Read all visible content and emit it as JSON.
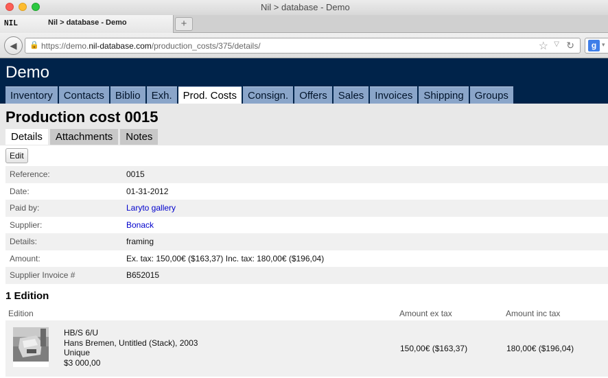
{
  "window": {
    "title": "Nil > database - Demo"
  },
  "browser": {
    "tab_logo": "NIL",
    "tab_title": "Nil > database - Demo",
    "new_tab": "+",
    "url_prefix": "https://demo.",
    "url_domain": "nil-database.com",
    "url_path": "/production_costs/375/details/",
    "search_engine_icon": "g"
  },
  "site": {
    "title": "Demo",
    "nav": [
      "Inventory",
      "Contacts",
      "Biblio",
      "Exh.",
      "Prod. Costs",
      "Consign.",
      "Offers",
      "Sales",
      "Invoices",
      "Shipping",
      "Groups"
    ],
    "active_nav": "Prod. Costs"
  },
  "page": {
    "title": "Production cost 0015",
    "tabs": [
      "Details",
      "Attachments",
      "Notes"
    ],
    "active_tab": "Details",
    "edit_label": "Edit"
  },
  "details": [
    {
      "label": "Reference:",
      "value": "0015",
      "link": false
    },
    {
      "label": "Date:",
      "value": "01-31-2012",
      "link": false
    },
    {
      "label": "Paid by:",
      "value": "Laryto gallery",
      "link": true
    },
    {
      "label": "Supplier:",
      "value": "Bonack",
      "link": true
    },
    {
      "label": "Details:",
      "value": "framing",
      "link": false
    },
    {
      "label": "Amount:",
      "value": "Ex. tax: 150,00€ ($163,37) Inc. tax: 180,00€ ($196,04)",
      "link": false
    },
    {
      "label": "Supplier Invoice #",
      "value": "B652015",
      "link": false
    }
  ],
  "editions": {
    "title": "1 Edition",
    "headers": {
      "edition": "Edition",
      "ex_tax": "Amount ex tax",
      "inc_tax": "Amount inc tax"
    },
    "rows": [
      {
        "code": "HB/S 6/U",
        "artwork": "Hans Bremen, Untitled (Stack), 2003",
        "edition_type": "Unique",
        "price": "$3 000,00",
        "ex_tax": "150,00€ ($163,37)",
        "inc_tax": "180,00€ ($196,04)"
      }
    ]
  },
  "colors": {
    "header_bg": "#00234a",
    "nav_bg": "#8aa5c9",
    "link": "#0000cc"
  },
  "icons": [
    "back-arrow-icon",
    "lock-icon",
    "star-icon",
    "dropdown-icon",
    "reload-icon",
    "google-icon"
  ]
}
